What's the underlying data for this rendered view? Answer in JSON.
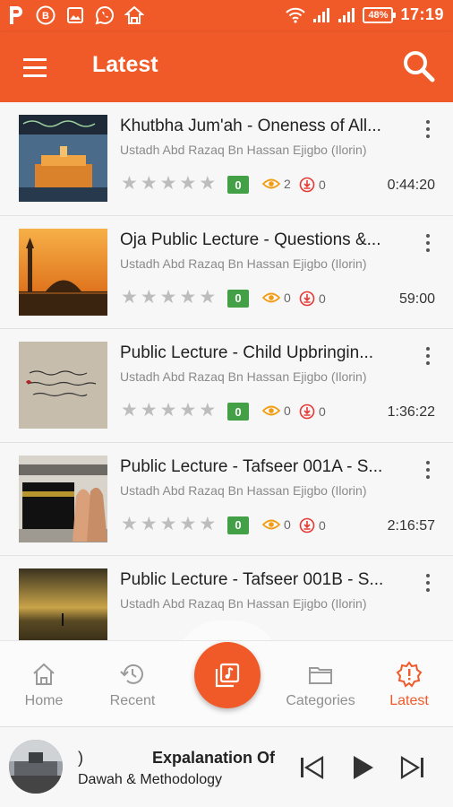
{
  "status_bar": {
    "time": "17:19",
    "battery": "48%",
    "left_icons": [
      "p-logo-icon",
      "b-icon",
      "image-icon",
      "whatsapp-icon",
      "home-icon"
    ],
    "right_icons": [
      "wifi-icon",
      "signal-icon",
      "signal-icon"
    ]
  },
  "app_bar": {
    "title": "Latest"
  },
  "colors": {
    "accent": "#f05a28",
    "badge": "#43a047",
    "download": "#e53935",
    "views": "#f39c12"
  },
  "items": [
    {
      "title": "Khutbha Jum'ah - Oneness of All...",
      "author": "Ustadh Abd Razaq Bn Hassan Ejigbo (Ilorin)",
      "rating": "0",
      "views": "2",
      "downloads": "0",
      "duration": "0:44:20",
      "thumb": "mosque-calligraphy"
    },
    {
      "title": "Oja Public Lecture - Questions &...",
      "author": "Ustadh Abd Razaq Bn Hassan Ejigbo (Ilorin)",
      "rating": "0",
      "views": "0",
      "downloads": "0",
      "duration": "59:00",
      "thumb": "mosque-sunset"
    },
    {
      "title": "Public Lecture - Child Upbringin...",
      "author": "Ustadh Abd Razaq Bn Hassan Ejigbo (Ilorin)",
      "rating": "0",
      "views": "0",
      "downloads": "0",
      "duration": "1:36:22",
      "thumb": "arabic-paper"
    },
    {
      "title": "Public Lecture - Tafseer 001A - S...",
      "author": "Ustadh Abd Razaq Bn Hassan Ejigbo (Ilorin)",
      "rating": "0",
      "views": "0",
      "downloads": "0",
      "duration": "2:16:57",
      "thumb": "kaaba-hands"
    },
    {
      "title": "Public Lecture - Tafseer 001B - S...",
      "author": "Ustadh Abd Razaq Bn Hassan Ejigbo (Ilorin)",
      "rating": "0",
      "views": "0",
      "downloads": "0",
      "duration": "",
      "thumb": "desert-sky"
    }
  ],
  "nav": {
    "home": "Home",
    "recent": "Recent",
    "categories": "Categories",
    "latest": "Latest",
    "active": "latest"
  },
  "player": {
    "title_lead": ")",
    "title": "Expalanation Of",
    "subtitle": "Dawah & Methodology"
  }
}
